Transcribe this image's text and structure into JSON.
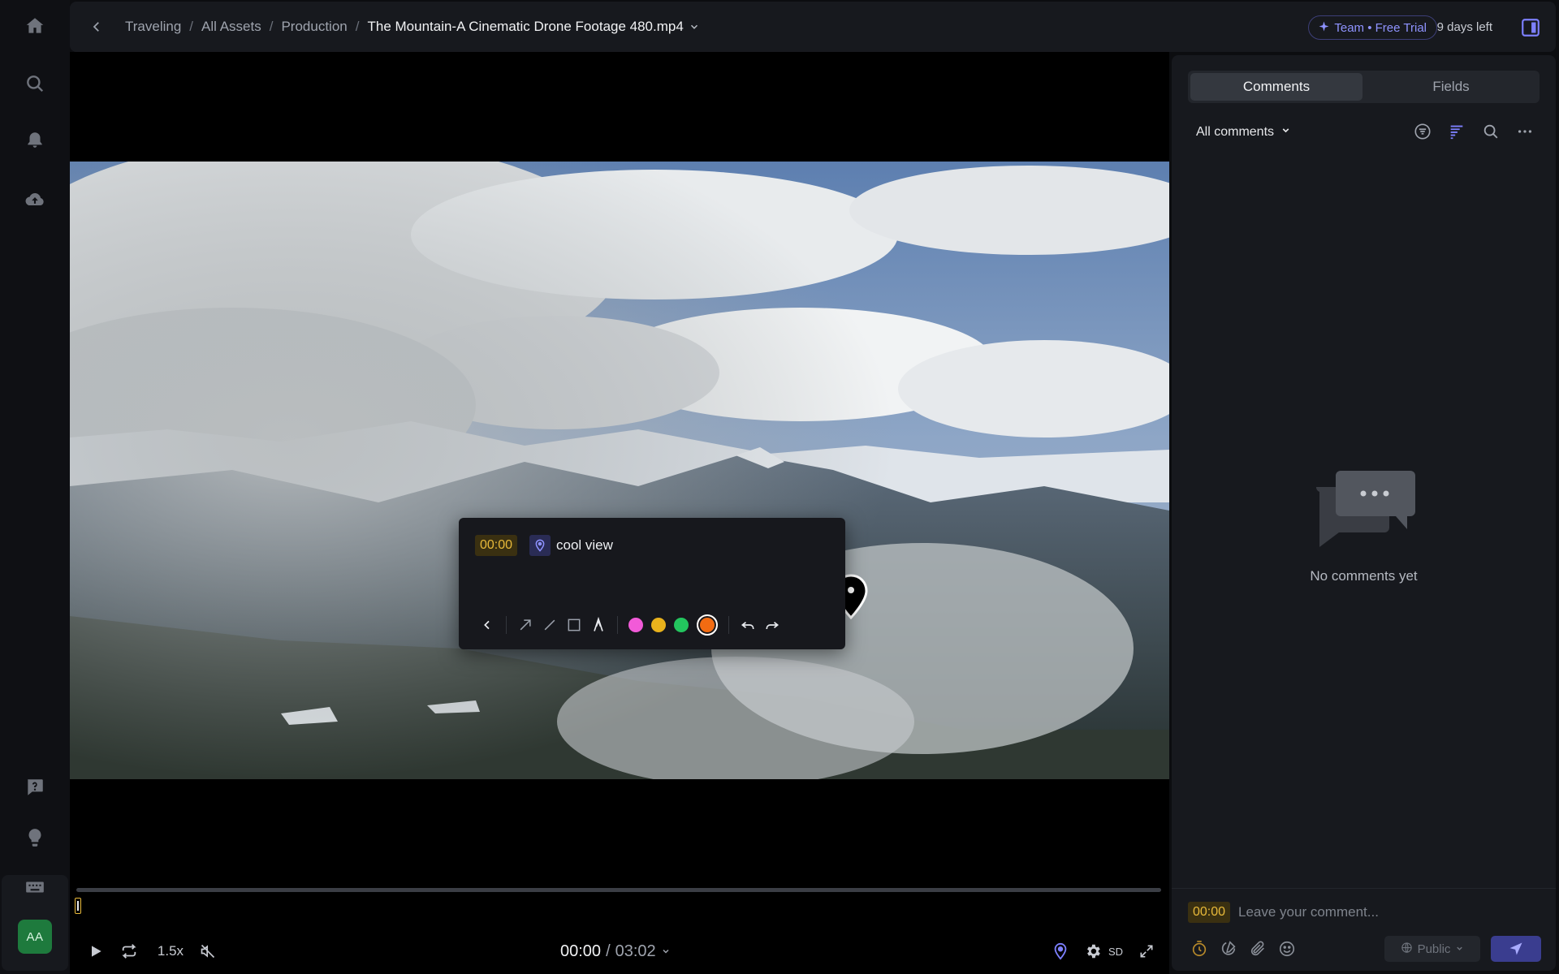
{
  "header": {
    "breadcrumbs": [
      "Traveling",
      "All Assets",
      "Production"
    ],
    "separator": "/",
    "current_file": "The Mountain-A Cinematic Drone Footage 480.mp4",
    "plan_badge": "Team • Free Trial",
    "trial_days": "9 days left"
  },
  "user": {
    "initials": "AA"
  },
  "annotation": {
    "timestamp": "00:00",
    "text": "cool view",
    "colors": [
      "#f25ad8",
      "#e9b21c",
      "#23c55e",
      "#f26b12"
    ],
    "selected_color": "#f26b12"
  },
  "player": {
    "speed": "1.5x",
    "current_time": "00:00",
    "separator": "/",
    "duration": "03:02",
    "quality": "SD",
    "progress": 0
  },
  "side_panel": {
    "tabs": [
      {
        "label": "Comments",
        "active": true
      },
      {
        "label": "Fields",
        "active": false
      }
    ],
    "filter_label": "All comments",
    "empty_message": "No comments yet"
  },
  "composer": {
    "timestamp": "00:00",
    "placeholder": "Leave your comment...",
    "visibility": "Public"
  },
  "colors": {
    "accent": "#7d80ff",
    "timestamp": "#e8b93a",
    "avatar": "#1e7a3d"
  }
}
